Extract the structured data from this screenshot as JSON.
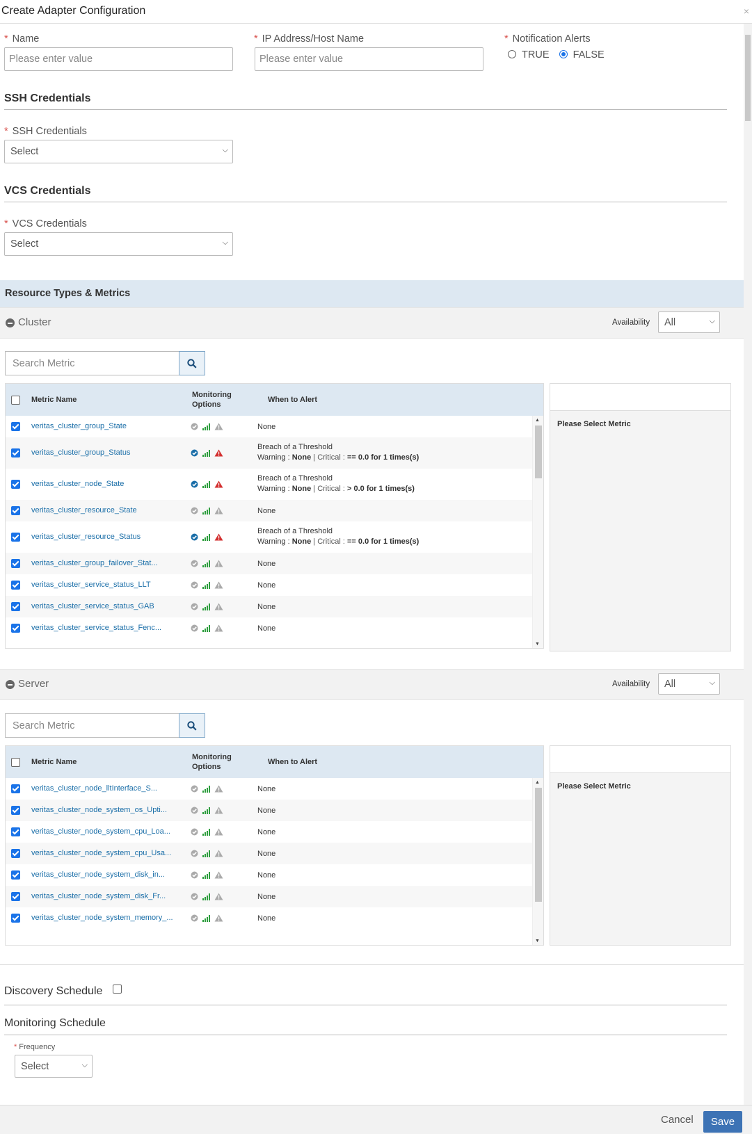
{
  "dialog": {
    "title": "Create Adapter Configuration",
    "close": "×"
  },
  "form": {
    "name_label": "Name",
    "name_placeholder": "Please enter value",
    "ip_label": "IP Address/Host Name",
    "ip_placeholder": "Please enter value",
    "notif_label": "Notification Alerts",
    "notif_true": "TRUE",
    "notif_false": "FALSE",
    "notif_selected": "FALSE"
  },
  "ssh": {
    "section_title": "SSH Credentials",
    "field_label": "SSH Credentials",
    "value": "Select"
  },
  "vcs": {
    "section_title": "VCS Credentials",
    "field_label": "VCS Credentials",
    "value": "Select"
  },
  "resources": {
    "title": "Resource Types & Metrics",
    "availability_label": "Availability",
    "search_placeholder": "Search Metric",
    "col_metric": "Metric Name",
    "col_monitoring": "Monitoring Options",
    "col_alert": "When to Alert",
    "side_text": "Please Select Metric",
    "groups": [
      {
        "name": "Cluster",
        "availability": "All",
        "rows": [
          {
            "name": "veritas_cluster_group_State",
            "alert": "None",
            "active": false
          },
          {
            "name": "veritas_cluster_group_Status",
            "alert_title": "Breach of a Threshold",
            "warn": "None",
            "crit": "== 0.0 for 1 times(s)",
            "active": true
          },
          {
            "name": "veritas_cluster_node_State",
            "alert_title": "Breach of a Threshold",
            "warn": "None",
            "crit": "> 0.0 for 1 times(s)",
            "active": true
          },
          {
            "name": "veritas_cluster_resource_State",
            "alert": "None",
            "active": false
          },
          {
            "name": "veritas_cluster_resource_Status",
            "alert_title": "Breach of a Threshold",
            "warn": "None",
            "crit": "== 0.0 for 1 times(s)",
            "active": true
          },
          {
            "name": "veritas_cluster_group_failover_Stat...",
            "alert": "None",
            "active": false
          },
          {
            "name": "veritas_cluster_service_status_LLT",
            "alert": "None",
            "active": false
          },
          {
            "name": "veritas_cluster_service_status_GAB",
            "alert": "None",
            "active": false
          },
          {
            "name": "veritas_cluster_service_status_Fenc...",
            "alert": "None",
            "active": false
          }
        ]
      },
      {
        "name": "Server",
        "availability": "All",
        "rows": [
          {
            "name": "veritas_cluster_node_lltInterface_S...",
            "alert": "None",
            "active": false
          },
          {
            "name": "veritas_cluster_node_system_os_Upti...",
            "alert": "None",
            "active": false
          },
          {
            "name": "veritas_cluster_node_system_cpu_Loa...",
            "alert": "None",
            "active": false
          },
          {
            "name": "veritas_cluster_node_system_cpu_Usa...",
            "alert": "None",
            "active": false
          },
          {
            "name": "veritas_cluster_node_system_disk_in...",
            "alert": "None",
            "active": false
          },
          {
            "name": "veritas_cluster_node_system_disk_Fr...",
            "alert": "None",
            "active": false
          },
          {
            "name": "veritas_cluster_node_system_memory_...",
            "alert": "None",
            "active": false
          }
        ]
      }
    ],
    "warning_label": "Warning :",
    "critical_label": "| Critical :"
  },
  "discovery": {
    "label": "Discovery Schedule"
  },
  "monitoring": {
    "title": "Monitoring Schedule",
    "freq_label": "Frequency",
    "freq_value": "Select"
  },
  "footer": {
    "cancel": "Cancel",
    "save": "Save"
  },
  "colors": {
    "accent": "#1a73e8",
    "link": "#1a6ea8",
    "save": "#3d73b5",
    "required": "#d9534f",
    "green": "#2e9e3e",
    "red": "#d32f2f"
  }
}
